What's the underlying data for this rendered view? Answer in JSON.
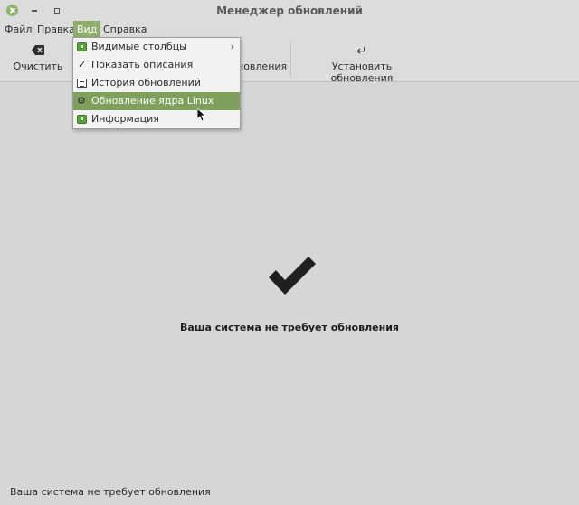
{
  "window": {
    "title": "Менеджер обновлений"
  },
  "menubar": {
    "items": [
      "Файл",
      "Правка",
      "Вид",
      "Справка"
    ]
  },
  "toolbar": {
    "clear_label": "Очистить",
    "clear_icon": "backspace-icon",
    "install_partial": "новления",
    "install_label": "Установить обновления",
    "install_icon": "return-arrow-icon"
  },
  "view_menu": {
    "items": [
      {
        "label": "Видимые столбцы",
        "icon": "green-window-icon",
        "submenu": true
      },
      {
        "label": "Показать описания",
        "icon": "check-icon"
      },
      {
        "label": "История обновлений",
        "icon": "document-icon"
      },
      {
        "label": "Обновление ядра Linux",
        "icon": "gear-icon",
        "highlighted": true
      },
      {
        "label": "Информация",
        "icon": "green-window-icon"
      }
    ]
  },
  "main": {
    "message": "Ваша система не требует обновления"
  },
  "statusbar": {
    "text": "Ваша система не требует обновления"
  },
  "colors": {
    "accent": "#8fae6e",
    "highlight": "#7fa05c",
    "background": "#d6d6d6",
    "icon_green": "#58a23b"
  }
}
